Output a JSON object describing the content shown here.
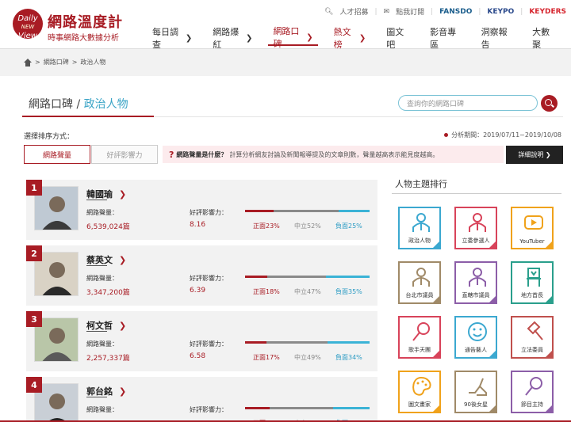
{
  "logo": {
    "circle_top": "Daily",
    "circle_mid": "NEW",
    "circle_bot": "View",
    "title": "網路溫度計",
    "subtitle": "時事網路大數據分析"
  },
  "toplinks": {
    "jobs": "人才招募",
    "subscribe": "點我訂閱",
    "fansdo": "FANSDO",
    "keypo": "KEYPO",
    "keyders": "KEYDERS"
  },
  "nav": [
    {
      "label": "每日調查",
      "chev": "❯"
    },
    {
      "label": "網路爆紅",
      "chev": "❯"
    },
    {
      "label": "網路口碑",
      "chev": "❯"
    },
    {
      "label": "熱文榜",
      "chev": "❯"
    },
    {
      "label": "圖文吧"
    },
    {
      "label": "影音專區"
    },
    {
      "label": "洞察報告"
    },
    {
      "label": "大數聚"
    }
  ],
  "breadcrumb": {
    "item1": "網路口碑",
    "item2": "政治人物",
    "sep": ">"
  },
  "page_title": {
    "main": "網路口碑",
    "sep": " / ",
    "sub": "政治人物"
  },
  "search": {
    "placeholder": "查詢你的網路口碑"
  },
  "sort": {
    "label": "選擇排序方式：",
    "tab1": "網路聲量",
    "tab2": "好評影響力"
  },
  "period": "分析期間：2019/07/11~2019/10/08",
  "info": {
    "q": "?",
    "bold": "網路聲量是什麼？",
    "text": "計算分析網友討論及新聞報導提及的文章則數，聲量越高表示能見度越高。"
  },
  "detail_btn": "詳細說明 ❯",
  "labels": {
    "volume": "網路聲量：",
    "influence": "好評影響力：",
    "pos": "正面",
    "neu": "中立",
    "neg": "負面"
  },
  "people": [
    {
      "rank": "1",
      "name": "韓國瑜",
      "volume": "6,539,024篇",
      "influence": "8.16",
      "pos": 23,
      "neu": 52,
      "neg": 25
    },
    {
      "rank": "2",
      "name": "蔡英文",
      "volume": "3,347,200篇",
      "influence": "6.39",
      "pos": 18,
      "neu": 47,
      "neg": 35
    },
    {
      "rank": "3",
      "name": "柯文哲",
      "volume": "2,257,337篇",
      "influence": "6.58",
      "pos": 17,
      "neu": 49,
      "neg": 34
    },
    {
      "rank": "4",
      "name": "郭台銘",
      "volume": "",
      "influence": "",
      "pos": 20,
      "neu": 51,
      "neg": 29
    }
  ],
  "right_panel": {
    "title": "人物主題排行",
    "tiles": [
      {
        "label": "政治人物",
        "icon": "person-icon",
        "color": "#3ba8d0"
      },
      {
        "label": "立委參選人",
        "icon": "person-icon",
        "color": "#d8435a"
      },
      {
        "label": "YouTuber",
        "icon": "play-icon",
        "color": "#f0a21b"
      },
      {
        "label": "台北市議員",
        "icon": "person-icon",
        "color": "#a08a68"
      },
      {
        "label": "直轄市議員",
        "icon": "person-icon",
        "color": "#8c5ea8"
      },
      {
        "label": "地方首長",
        "icon": "chair-icon",
        "color": "#2a9f8c"
      },
      {
        "label": "歌手天團",
        "icon": "microphone-icon",
        "color": "#d8435a"
      },
      {
        "label": "通告藝人",
        "icon": "smiley-icon",
        "color": "#3ba8d0"
      },
      {
        "label": "立法委員",
        "icon": "gavel-icon",
        "color": "#c0504d"
      },
      {
        "label": "圖文畫家",
        "icon": "palette-icon",
        "color": "#f0a21b"
      },
      {
        "label": "90後女星",
        "icon": "heel-icon",
        "color": "#a08a68"
      },
      {
        "label": "節目主持",
        "icon": "microphone-icon",
        "color": "#8c5ea8"
      }
    ]
  }
}
